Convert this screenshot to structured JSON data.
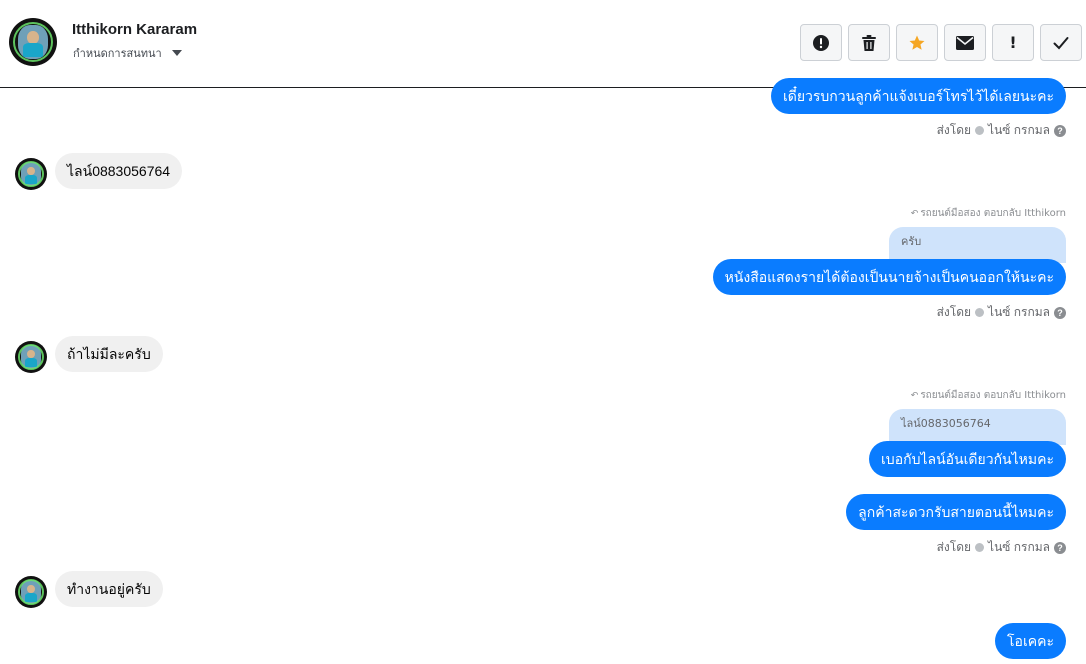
{
  "header": {
    "contact_name": "Itthikorn Kararam",
    "assign_label": "กำหนดการสนทนา"
  },
  "toolbar": {
    "buttons": [
      {
        "name": "mark-spam-button",
        "icon": "alert-circle-icon"
      },
      {
        "name": "delete-button",
        "icon": "trash-icon"
      },
      {
        "name": "star-button",
        "icon": "star-icon",
        "color": "#f5a623"
      },
      {
        "name": "mark-unread-button",
        "icon": "envelope-icon"
      },
      {
        "name": "follow-up-button",
        "icon": "exclamation-icon",
        "glyph": "!"
      },
      {
        "name": "mark-done-button",
        "icon": "checkmark-icon"
      }
    ]
  },
  "colors": {
    "outgoing_bubble": "#0a7cff",
    "incoming_bubble": "#f0f0f0",
    "quote_bubble": "#cfe3fb"
  },
  "messages": {
    "m1_out": "เดี๋ยวรบกวนลูกค้าแจ้งเบอร์โทรไว้ได้เลยนะคะ",
    "sent_by_label": "ส่งโดย",
    "sender_name": "ไนซ์ กรกมล",
    "m2_in": "ไลน์0883056764",
    "reply1_meta": "รถยนต์มือสอง ตอบกลับ Itthikorn",
    "reply1_quote": "ครับ",
    "m3_out": "หนังสือแสดงรายได้ต้องเป็นนายจ้างเป็นคนออกให้นะคะ",
    "m4_in": "ถ้าไม่มีละครับ",
    "reply2_meta": "รถยนต์มือสอง ตอบกลับ Itthikorn",
    "reply2_quote": "ไลน์0883056764",
    "m5_out": "เบอกับไลน์อันเดียวกันไหมคะ",
    "m6_out": "ลูกค้าสะดวกรับสายตอนนี้ไหมคะ",
    "m7_in": "ทำงานอยู่ครับ",
    "m8_out": "โอเคคะ"
  }
}
